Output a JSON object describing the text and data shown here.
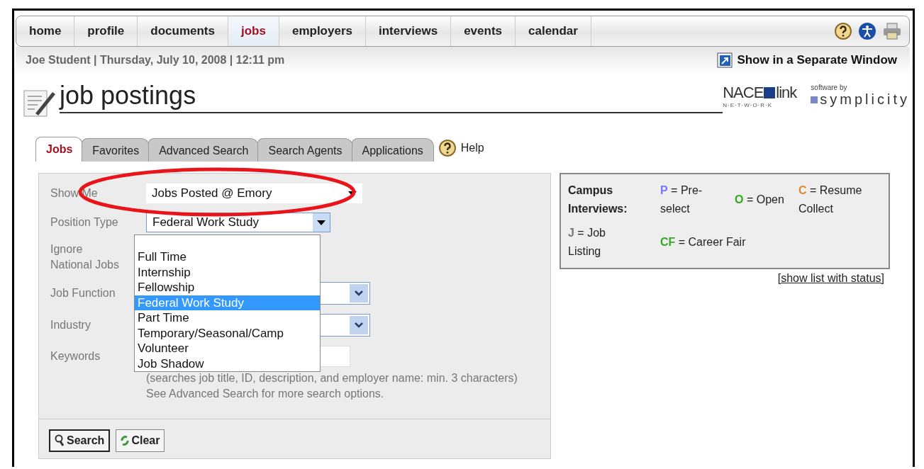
{
  "nav": {
    "items": [
      {
        "label": "home",
        "selected": false
      },
      {
        "label": "profile",
        "selected": false
      },
      {
        "label": "documents",
        "selected": false
      },
      {
        "label": "jobs",
        "selected": true
      },
      {
        "label": "employers",
        "selected": false
      },
      {
        "label": "interviews",
        "selected": false
      },
      {
        "label": "events",
        "selected": false
      },
      {
        "label": "calendar",
        "selected": false
      }
    ]
  },
  "info_bar": {
    "text": "Joe Student | Thursday, July 10, 2008 | 12:11 pm",
    "link": "Show in a Separate Window"
  },
  "page_title": "job postings",
  "logos": {
    "nace": "NACE",
    "nace_link": "link",
    "network": "N·E·T·W·O·R·K",
    "software_by": "software by",
    "symplicity": "symplicity"
  },
  "tabs": [
    {
      "label": "Jobs",
      "selected": true
    },
    {
      "label": "Favorites",
      "selected": false
    },
    {
      "label": "Advanced Search",
      "selected": false
    },
    {
      "label": "Search Agents",
      "selected": false
    },
    {
      "label": "Applications",
      "selected": false
    }
  ],
  "help": "Help",
  "form": {
    "show_me": {
      "label": "Show Me",
      "value": "Jobs Posted @ Emory"
    },
    "position_type": {
      "label": "Position Type",
      "value": "Federal Work Study",
      "options": [
        {
          "label": "Full Time",
          "selected": false
        },
        {
          "label": "Internship",
          "selected": false
        },
        {
          "label": "Fellowship",
          "selected": false
        },
        {
          "label": "Federal Work Study",
          "selected": true
        },
        {
          "label": "Part Time",
          "selected": false
        },
        {
          "label": "Temporary/Seasonal/Camp",
          "selected": false
        },
        {
          "label": "Volunteer",
          "selected": false
        },
        {
          "label": "Job Shadow",
          "selected": false
        }
      ]
    },
    "ignore_national": "Ignore National Jobs",
    "job_function": "Job Function",
    "industry": "Industry",
    "keywords": "Keywords",
    "hint": "(searches job title, ID, description, and employer name: min. 3 characters)",
    "hint2": "See Advanced Search for more search options.",
    "buttons": [
      "Search",
      "Clear"
    ]
  },
  "legend": {
    "title": "Campus Interviews:",
    "items": [
      {
        "code": "P",
        "text": "= Pre-select",
        "color": "#7777ff"
      },
      {
        "code": "O",
        "text": "= Open",
        "color": "#33aa22"
      },
      {
        "code": "C",
        "text": "= Resume Collect",
        "color": "#dd8833"
      },
      {
        "code": "J",
        "text": "= Job Listing",
        "color": "#777777"
      },
      {
        "code": "CF",
        "text": "= Career Fair",
        "color": "#33aa22"
      }
    ],
    "link": "[show list with status]"
  }
}
